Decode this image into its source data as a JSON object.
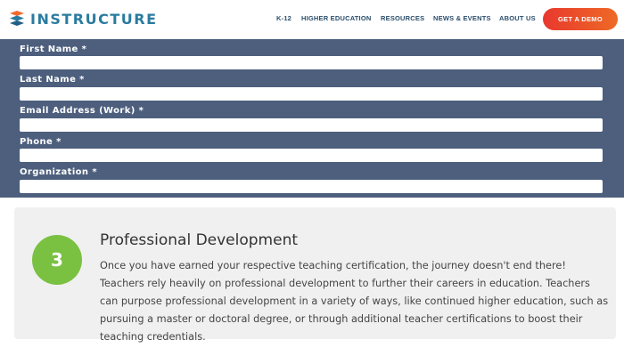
{
  "header": {
    "logo_text": "INSTRUCTURE",
    "logo_icon": "instructure-logo-icon",
    "nav": [
      {
        "label": "K-12"
      },
      {
        "label": "HIGHER EDUCATION"
      },
      {
        "label": "RESOURCES"
      },
      {
        "label": "NEWS & EVENTS"
      },
      {
        "label": "ABOUT US"
      }
    ],
    "cta_label": "GET A DEMO"
  },
  "form": {
    "fields": [
      {
        "label": "First Name *",
        "value": ""
      },
      {
        "label": "Last Name *",
        "value": ""
      },
      {
        "label": "Email Address (Work) *",
        "value": ""
      },
      {
        "label": "Phone *",
        "value": ""
      },
      {
        "label": "Organization *",
        "value": ""
      }
    ]
  },
  "step": {
    "number": "3",
    "title": "Professional Development",
    "body": "Once you have earned your respective teaching certification, the journey doesn't end there! Teachers rely heavily on professional development to further their careers in education. Teachers can purpose professional development in a variety of ways, like continued higher education, such as pursuing a master or doctoral degree, or through additional teacher certifications to boost their teaching credentials."
  },
  "colors": {
    "brand_blue": "#2a7ba0",
    "form_bg": "#4d5f7d",
    "cta_start": "#e8382e",
    "cta_end": "#ee6a25",
    "step_green": "#7ac142",
    "card_bg": "#f0f0f0"
  }
}
